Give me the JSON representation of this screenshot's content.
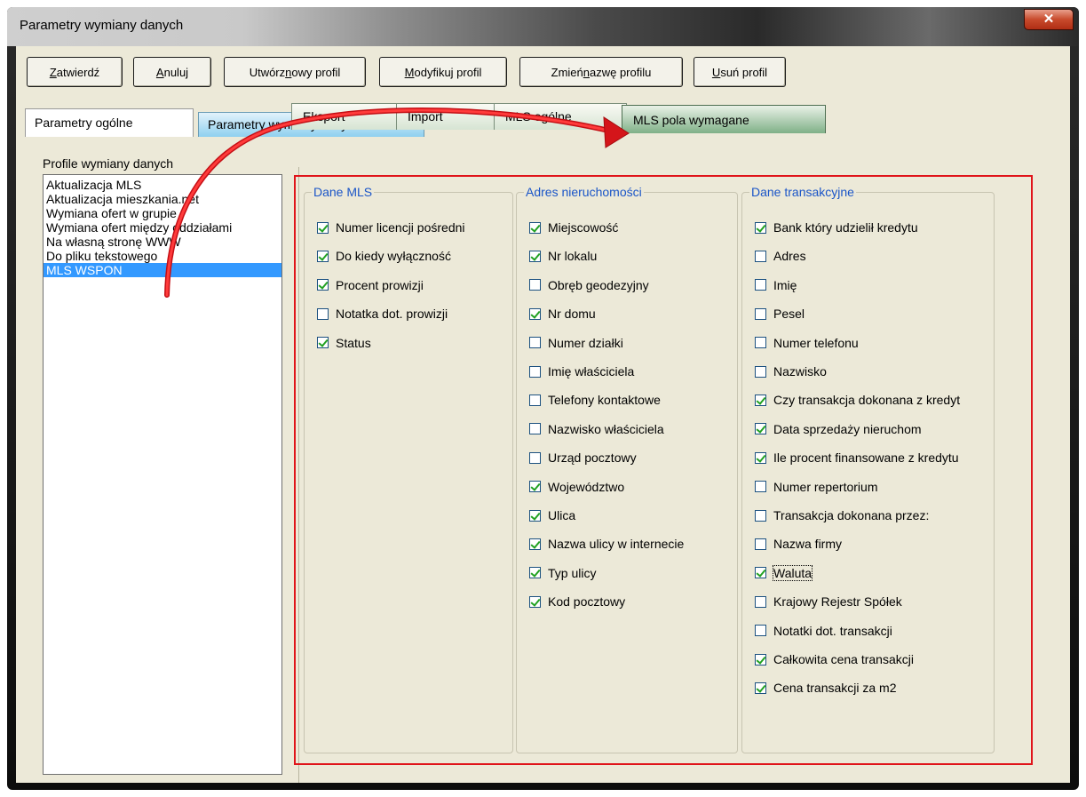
{
  "window": {
    "title": "Parametry wymiany danych"
  },
  "toolbar": {
    "confirm": {
      "first": "Z",
      "rest": "atwierdź"
    },
    "cancel": {
      "first": "A",
      "rest": "nuluj"
    },
    "new_profile": {
      "pre": "Utwórz ",
      "ul": "n",
      "post": "owy profil"
    },
    "modify_profile": {
      "first": "M",
      "rest": "odyfikuj profil"
    },
    "rename_profile": {
      "pre": "Zmień ",
      "ul": "n",
      "post": "azwę profilu"
    },
    "delete_profile": {
      "first": "U",
      "rest": "suń profil"
    }
  },
  "top_tabs": [
    "Parametry ogólne",
    "Parametry wymiany danych"
  ],
  "profiles": {
    "label": "Profile wymiany danych",
    "items": [
      "Aktualizacja MLS",
      "Aktualizacja mieszkania.net",
      "Wymiana ofert w grupie",
      "Wymiana ofert między oddziałami",
      "Na własną stronę WWW",
      "Do pliku tekstowego",
      "MLS WSPON"
    ],
    "selected": "MLS WSPON"
  },
  "inner_tabs": [
    "Eksport",
    "Import",
    "MLS ogólne",
    "MLS pola wymagane"
  ],
  "groups": [
    {
      "title": "Dane MLS",
      "fields": [
        {
          "label": "Numer licencji pośredni",
          "checked": true
        },
        {
          "label": "Do kiedy wyłączność",
          "checked": true
        },
        {
          "label": "Procent prowizji",
          "checked": true
        },
        {
          "label": "Notatka dot. prowizji",
          "checked": false
        },
        {
          "label": "Status",
          "checked": true
        }
      ]
    },
    {
      "title": "Adres nieruchomości",
      "fields": [
        {
          "label": "Miejscowość",
          "checked": true
        },
        {
          "label": "Nr lokalu",
          "checked": true
        },
        {
          "label": "Obręb geodezyjny",
          "checked": false
        },
        {
          "label": "Nr domu",
          "checked": true
        },
        {
          "label": "Numer działki",
          "checked": false
        },
        {
          "label": "Imię właściciela",
          "checked": false
        },
        {
          "label": "Telefony kontaktowe",
          "checked": false
        },
        {
          "label": "Nazwisko właściciela",
          "checked": false
        },
        {
          "label": "Urząd pocztowy",
          "checked": false
        },
        {
          "label": "Województwo",
          "checked": true
        },
        {
          "label": "Ulica",
          "checked": true
        },
        {
          "label": "Nazwa ulicy w internecie",
          "checked": true
        },
        {
          "label": "Typ ulicy",
          "checked": true
        },
        {
          "label": "Kod pocztowy",
          "checked": true
        }
      ]
    },
    {
      "title": "Dane transakcyjne",
      "fields": [
        {
          "label": "Bank który udzielił kredytu",
          "checked": true
        },
        {
          "label": "Adres",
          "checked": false
        },
        {
          "label": "Imię",
          "checked": false
        },
        {
          "label": "Pesel",
          "checked": false
        },
        {
          "label": "Numer telefonu",
          "checked": false
        },
        {
          "label": "Nazwisko",
          "checked": false
        },
        {
          "label": "Czy transakcja dokonana z kredyt",
          "checked": true
        },
        {
          "label": "Data sprzedaży nieruchom",
          "checked": true
        },
        {
          "label": "Ile procent finansowane z kredytu",
          "checked": true
        },
        {
          "label": "Numer repertorium",
          "checked": false
        },
        {
          "label": "Transakcja dokonana przez:",
          "checked": false
        },
        {
          "label": "Nazwa firmy",
          "checked": false
        },
        {
          "label": "Waluta",
          "checked": true
        },
        {
          "label": "Krajowy Rejestr Spółek",
          "checked": false
        },
        {
          "label": "Notatki dot. transakcji",
          "checked": false
        },
        {
          "label": "Całkowita cena transakcji",
          "checked": true
        },
        {
          "label": "Cena transakcji za m2",
          "checked": true
        }
      ]
    }
  ],
  "focused_field": "Waluta",
  "colors": {
    "selection": "#3399ff",
    "group_title": "#1a55c8",
    "annotation": "#e0141a",
    "check": "#21a121"
  }
}
